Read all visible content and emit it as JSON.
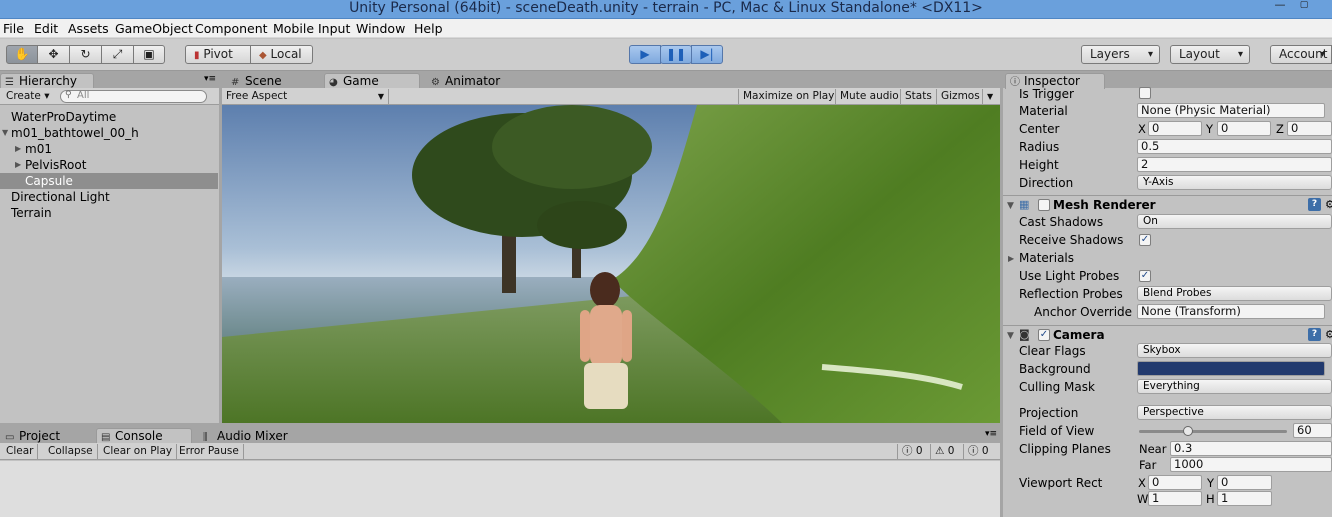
{
  "window": {
    "title": "Unity Personal (64bit) - sceneDeath.unity - terrain - PC, Mac & Linux Standalone* <DX11>"
  },
  "menu": [
    "File",
    "Edit",
    "Assets",
    "GameObject",
    "Component",
    "Mobile Input",
    "Window",
    "Help"
  ],
  "toolbar": {
    "pivot": "Pivot",
    "local": "Local",
    "layers": "Layers",
    "layout": "Layout",
    "account": "Account"
  },
  "hierarchy": {
    "tab": "Hierarchy",
    "create": "Create",
    "search_placeholder": "All",
    "items": [
      "WaterProDaytime",
      "m01_bathtowel_00_h",
      "m01",
      "PelvisRoot",
      "Capsule",
      "Directional Light",
      "Terrain"
    ]
  },
  "scene_tabs": {
    "scene": "Scene",
    "game": "Game",
    "animator": "Animator"
  },
  "game_toolbar": {
    "aspect": "Free Aspect",
    "maximize": "Maximize on Play",
    "mute": "Mute audio",
    "stats": "Stats",
    "gizmos": "Gizmos"
  },
  "bottom_tabs": {
    "project": "Project",
    "console": "Console",
    "audio": "Audio Mixer"
  },
  "console": {
    "clear": "Clear",
    "collapse": "Collapse",
    "clear_on_play": "Clear on Play",
    "error_pause": "Error Pause",
    "info_count": "0",
    "warn_count": "0",
    "error_count": "0"
  },
  "inspector": {
    "tab": "Inspector",
    "collider": {
      "is_trigger": "Is Trigger",
      "material_label": "Material",
      "material_value": "None (Physic Material)",
      "center_label": "Center",
      "cx": "0",
      "cy": "0",
      "cz": "0",
      "radius_label": "Radius",
      "radius_value": "0.5",
      "height_label": "Height",
      "height_value": "2",
      "direction_label": "Direction",
      "direction_value": "Y-Axis"
    },
    "mesh_renderer": {
      "title": "Mesh Renderer",
      "cast_label": "Cast Shadows",
      "cast_value": "On",
      "receive_label": "Receive Shadows",
      "materials_label": "Materials",
      "light_probes_label": "Use Light Probes",
      "refl_label": "Reflection Probes",
      "refl_value": "Blend Probes",
      "anchor_label": "Anchor Override",
      "anchor_value": "None (Transform)"
    },
    "camera": {
      "title": "Camera",
      "clear_flags_label": "Clear Flags",
      "clear_flags_value": "Skybox",
      "background_label": "Background",
      "background_color": "#223a6e",
      "culling_label": "Culling Mask",
      "culling_value": "Everything",
      "projection_label": "Projection",
      "projection_value": "Perspective",
      "fov_label": "Field of View",
      "fov_value": "60",
      "fov_fraction": 0.33,
      "clip_label": "Clipping Planes",
      "near_label": "Near",
      "near_value": "0.3",
      "far_label": "Far",
      "far_value": "1000",
      "viewport_label": "Viewport Rect",
      "vx": "0",
      "vy": "0",
      "vw": "1",
      "vh": "1"
    },
    "axis_x": "X",
    "axis_y": "Y",
    "axis_z": "Z",
    "axis_w": "W",
    "axis_h": "H"
  },
  "colors": {
    "accent": "#3d7ecf",
    "selection": "#8e8e8e",
    "titlebar": "#6aa0dc"
  }
}
